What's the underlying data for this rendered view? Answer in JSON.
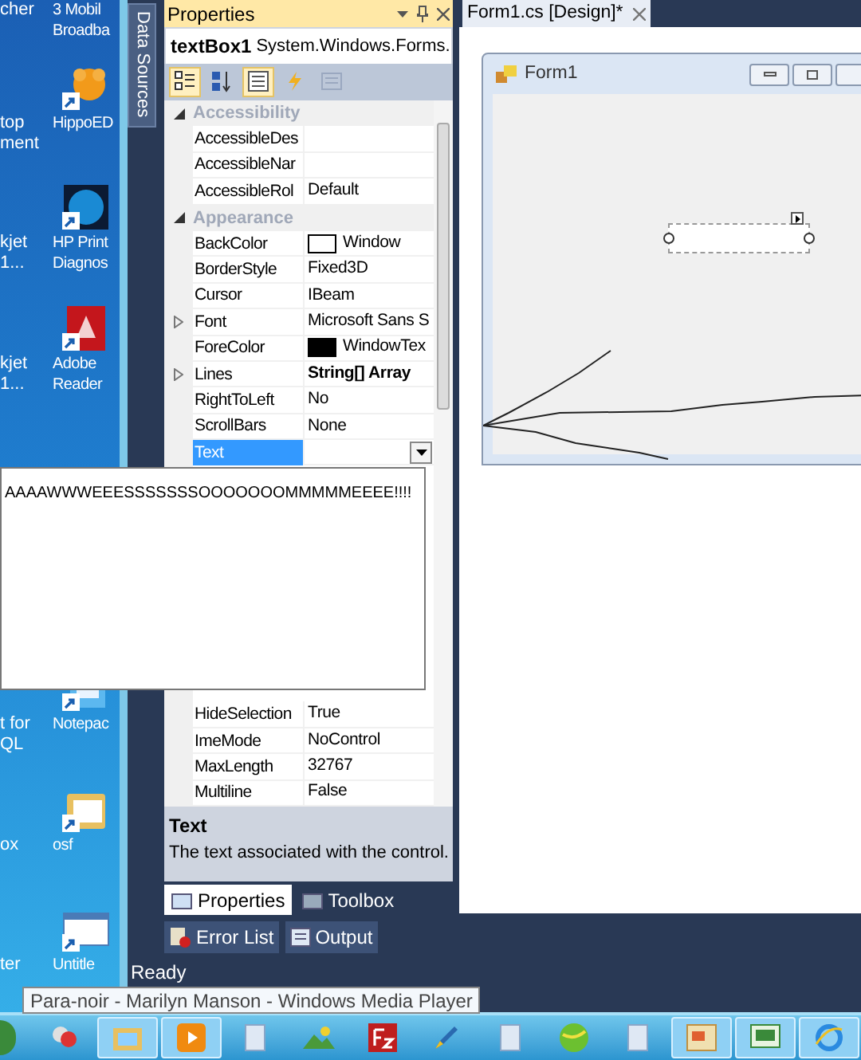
{
  "desktop": {
    "left_column": [
      {
        "lines": [
          "cher"
        ]
      },
      {
        "lines": [
          "top",
          "ment"
        ]
      },
      {
        "lines": [
          "kjet",
          "1..."
        ]
      },
      {
        "lines": [
          "kjet",
          "1..."
        ]
      },
      {
        "lines": [
          "t for",
          "QL"
        ]
      },
      {
        "lines": [
          "ox"
        ]
      },
      {
        "lines": [
          "ter"
        ]
      }
    ],
    "right_column": [
      {
        "lines": [
          "3 Mobil",
          "Broadba"
        ]
      },
      {
        "kind": "hippo",
        "lines": [
          "HippoED"
        ]
      },
      {
        "kind": "hp",
        "lines": [
          "HP Print",
          "Diagnos"
        ]
      },
      {
        "kind": "pdf",
        "lines": [
          "Adobe",
          "Reader"
        ]
      },
      {
        "kind": "notepad",
        "lines": [
          "Notepac"
        ]
      },
      {
        "kind": "folder",
        "lines": [
          "osf"
        ]
      },
      {
        "kind": "window",
        "lines": [
          "Untitle"
        ]
      }
    ]
  },
  "data_sources_tab": "Data Sources",
  "properties": {
    "title": "Properties",
    "object": "textBox1",
    "object_type": "System.Windows.Forms.",
    "toolbar": [
      {
        "kind": "categorized",
        "selected": true
      },
      {
        "kind": "alphabetical",
        "selected": false
      },
      {
        "kind": "properties",
        "selected": true
      },
      {
        "kind": "events",
        "selected": false
      },
      {
        "kind": "pages",
        "selected": false
      }
    ],
    "rows": [
      {
        "kind": "category",
        "name": "Accessibility",
        "expanded": true
      },
      {
        "kind": "property",
        "name": "AccessibleDes"
      },
      {
        "kind": "property",
        "name": "AccessibleNar"
      },
      {
        "kind": "property",
        "name": "AccessibleRol",
        "value": "Default"
      },
      {
        "kind": "category",
        "name": "Appearance",
        "expanded": true
      },
      {
        "kind": "property",
        "name": "BackColor",
        "value": "Window",
        "color": "#ffffff"
      },
      {
        "kind": "property",
        "name": "BorderStyle",
        "value": "Fixed3D"
      },
      {
        "kind": "property",
        "name": "Cursor",
        "value": "IBeam"
      },
      {
        "kind": "property",
        "name": "Font",
        "value": "Microsoft Sans S",
        "expanded": false
      },
      {
        "kind": "property",
        "name": "ForeColor",
        "value": "WindowTex",
        "color": "#000000"
      },
      {
        "kind": "property",
        "name": "Lines",
        "value": "String[] Array",
        "expanded": false,
        "modified": true
      },
      {
        "kind": "property",
        "name": "RightToLeft",
        "value": "No"
      },
      {
        "kind": "property",
        "name": "ScrollBars",
        "value": "None"
      },
      {
        "kind": "property",
        "name": "Text",
        "selected": true
      }
    ],
    "lower_rows": [
      {
        "kind": "property",
        "name": "HideSelection",
        "value": "True"
      },
      {
        "kind": "property",
        "name": "ImeMode",
        "value": "NoControl"
      },
      {
        "kind": "property",
        "name": "MaxLength",
        "value": "32767"
      },
      {
        "kind": "property",
        "name": "Multiline",
        "value": "False"
      }
    ],
    "description": {
      "title": "Text",
      "text": "The text associated with the control."
    },
    "tabs": [
      {
        "label": "Properties",
        "selected": true
      },
      {
        "label": "Toolbox",
        "selected": false
      }
    ]
  },
  "text_popup": {
    "value": "AAAAWWWEEESSSSSSSOOOOOOOMMMMMEEEE!!!!"
  },
  "bottom_tabs": [
    {
      "kind": "errors",
      "label": "Error List"
    },
    {
      "kind": "output",
      "label": "Output"
    }
  ],
  "status": "Ready",
  "designer": {
    "tab": "Form1.cs [Design]*",
    "form_title": "Form1"
  },
  "taskbar": {
    "tooltip": "Para-noir - Marilyn Manson - Windows Media Player",
    "buttons": [
      {
        "kind": "messenger",
        "active": false
      },
      {
        "kind": "folder",
        "active": true
      },
      {
        "kind": "media",
        "active": true
      },
      {
        "kind": "document",
        "active": false
      },
      {
        "kind": "landscape",
        "active": false
      },
      {
        "kind": "filezilla",
        "active": false
      },
      {
        "kind": "pen",
        "active": false
      },
      {
        "kind": "document",
        "active": false
      },
      {
        "kind": "ball",
        "active": false
      },
      {
        "kind": "document",
        "active": false
      },
      {
        "kind": "window",
        "active": true
      },
      {
        "kind": "csharp",
        "active": true
      },
      {
        "kind": "browser",
        "active": true
      }
    ]
  }
}
